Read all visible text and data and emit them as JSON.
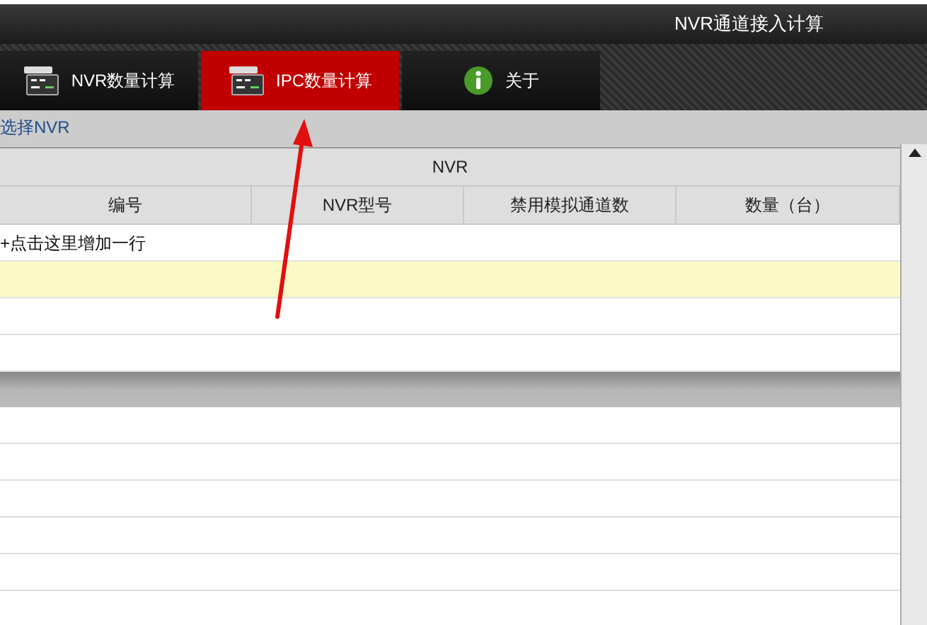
{
  "window": {
    "title": "NVR通道接入计算"
  },
  "tabs": [
    {
      "label": "NVR数量计算",
      "selected": false,
      "kind": "device"
    },
    {
      "label": "IPC数量计算",
      "selected": true,
      "kind": "device"
    },
    {
      "label": "关于",
      "selected": false,
      "kind": "info"
    }
  ],
  "section_label": "选择NVR",
  "table": {
    "group_header": "NVR",
    "columns": [
      "编号",
      "NVR型号",
      "禁用模拟通道数",
      "数量（台）"
    ],
    "rows": [
      {
        "kind": "add",
        "text": "+点击这里增加一行",
        "selected": false
      },
      {
        "kind": "empty",
        "selected": true
      },
      {
        "kind": "empty",
        "selected": false
      },
      {
        "kind": "empty",
        "selected": false
      }
    ]
  }
}
